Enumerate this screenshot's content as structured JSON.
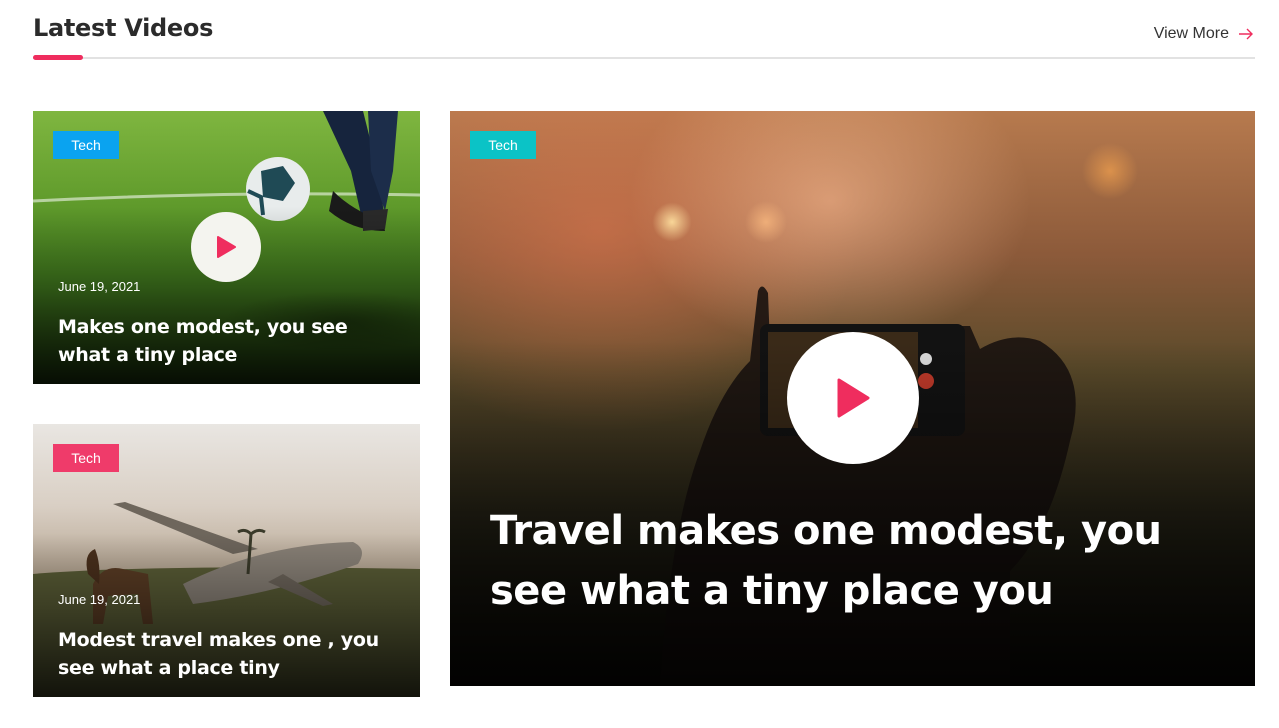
{
  "section": {
    "title": "Latest Videos",
    "view_more_label": "View More",
    "accent_color": "#ef2d5e"
  },
  "cards": [
    {
      "category": "Tech",
      "category_color": "#0aa3f0",
      "date": "June 19, 2021",
      "title": "Makes one modest, you see what a tiny place",
      "icon": "play-icon"
    },
    {
      "category": "Tech",
      "category_color": "#ef3b6a",
      "date": "June 19, 2021",
      "title": "Modest travel makes one , you see what a place tiny",
      "icon": "play-icon"
    },
    {
      "category": "Tech",
      "category_color": "#0bc3c6",
      "title": "Travel makes one modest, you see what a tiny place you",
      "icon": "play-icon"
    }
  ]
}
